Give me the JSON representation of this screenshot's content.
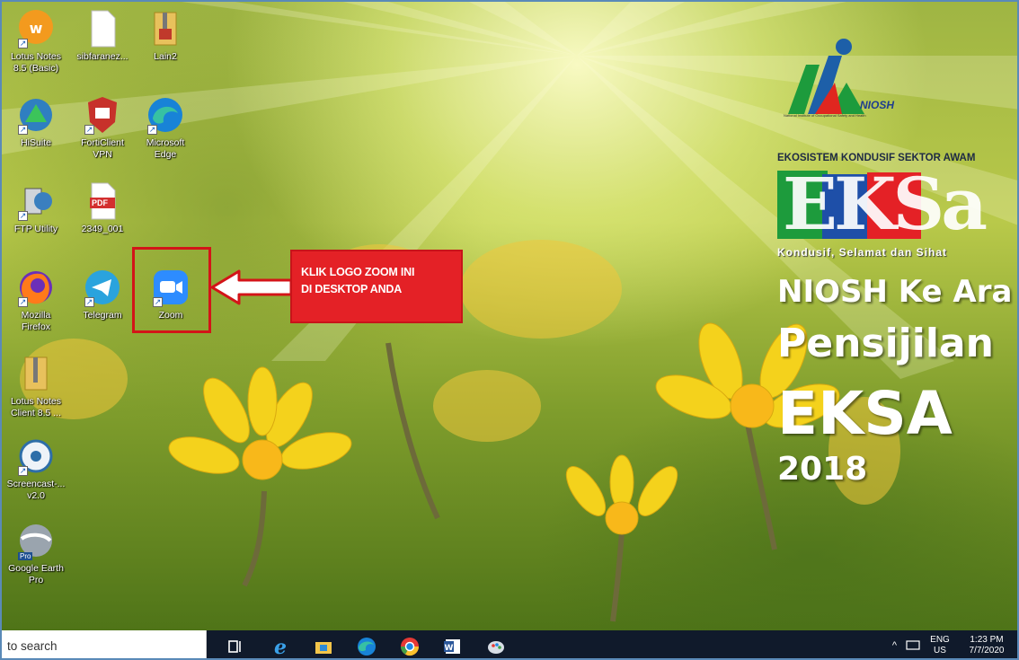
{
  "desktop": {
    "icons": [
      {
        "label_line1": "Lotus Notes",
        "label_line2": "8.5 (Basic)"
      },
      {
        "label_line1": "sibfaranez...",
        "label_line2": ""
      },
      {
        "label_line1": "Lain2",
        "label_line2": ""
      },
      {
        "label_line1": "HiSuite",
        "label_line2": ""
      },
      {
        "label_line1": "FortiClient",
        "label_line2": "VPN"
      },
      {
        "label_line1": "Microsoft",
        "label_line2": "Edge"
      },
      {
        "label_line1": "FTP Utility",
        "label_line2": ""
      },
      {
        "label_line1": "2349_001",
        "label_line2": ""
      },
      {
        "label_line1": "Mozilla",
        "label_line2": "Firefox"
      },
      {
        "label_line1": "Telegram",
        "label_line2": ""
      },
      {
        "label_line1": "Zoom",
        "label_line2": ""
      },
      {
        "label_line1": "Lotus Notes",
        "label_line2": "Client 8.5 ..."
      },
      {
        "label_line1": "Screencast-...",
        "label_line2": "v2.0"
      },
      {
        "label_line1": "Google Earth",
        "label_line2": "Pro"
      }
    ],
    "pdf_badge": "PDF",
    "pro_badge": "Pro"
  },
  "callout": {
    "line1": "KLIK LOGO ZOOM INI",
    "line2": "DI DESKTOP ANDA"
  },
  "wallpaper": {
    "niosh_logo_text": "NIOSH",
    "niosh_tagline": "National Institute of Occupational Safety and Health",
    "eksa_heading": "EKOSISTEM KONDUSIF SEKTOR AWAM",
    "eksa_logo_letters": "EKSa",
    "eksa_tagline": "Kondusif, Selamat dan Sihat",
    "line_niosh": "NIOSH Ke Ara",
    "line_pensijilan": "Pensijilan",
    "line_eksa": "EKSA",
    "line_year": "2018"
  },
  "taskbar": {
    "search_placeholder": "to search",
    "tray_lang": "ENG",
    "tray_region": "US",
    "tray_time": "1:23 PM",
    "tray_date": "7/7/2020"
  },
  "colors": {
    "callout_red": "#e42126",
    "taskbar": "#101a2b",
    "zoom_blue": "#2d8cff"
  }
}
